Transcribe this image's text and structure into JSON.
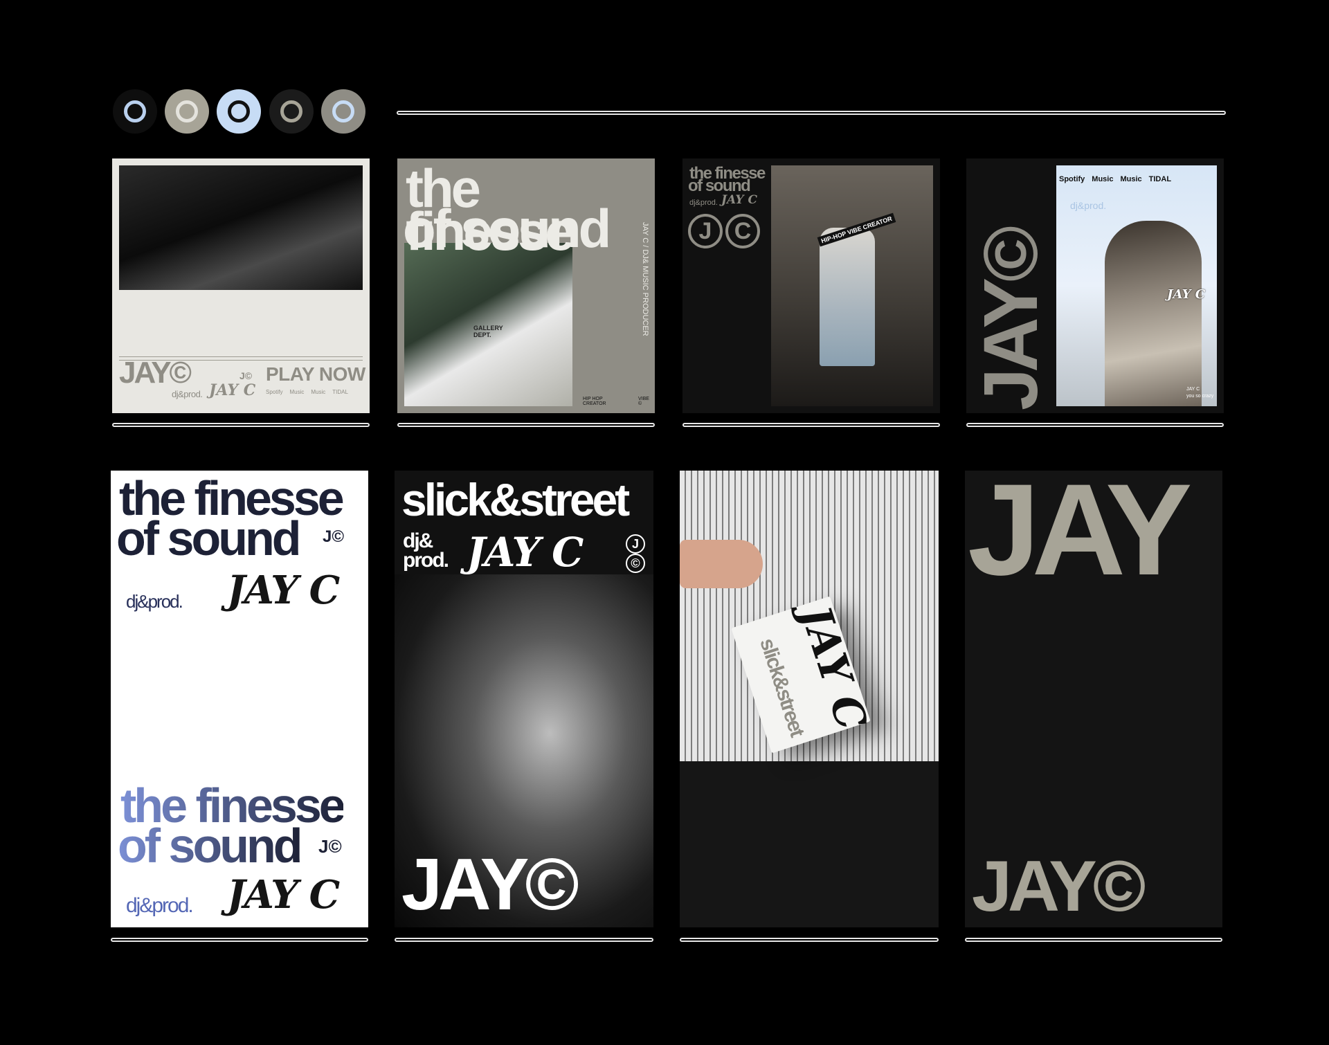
{
  "palette": {
    "swatches": [
      {
        "name": "swatch-black",
        "bg": "#0e0e0e",
        "ring": "#b9d0ee"
      },
      {
        "name": "swatch-taupe",
        "bg": "#a7a497",
        "ring": "#e4e3dd"
      },
      {
        "name": "swatch-blue",
        "bg": "#c7dcf5",
        "ring": "#111111"
      },
      {
        "name": "swatch-charcoal",
        "bg": "#1b1b1b",
        "ring": "#a7a497"
      },
      {
        "name": "swatch-grey",
        "bg": "#8f8d85",
        "ring": "#c7dcf5"
      }
    ]
  },
  "cards": {
    "c1": {
      "brand": "JAY©",
      "mark": "J©",
      "cta": "PLAY NOW",
      "sub": "dj&prod.",
      "sig": "JAY C",
      "platforms": [
        "Spotify",
        "Music",
        "Music",
        "TIDAL"
      ]
    },
    "c2": {
      "headline1": "the finesse",
      "headline2": "of sound",
      "vertical": "JAY C / DJ& MUSIC PRODUCER",
      "tag1": "HIP HOP CREATOR",
      "tag2": "VIBE ©",
      "shirt": "GALLERY DEPT."
    },
    "c3": {
      "headline1": "the finesse",
      "headline2": "of sound",
      "sub": "dj&prod.",
      "sig": "JAY C",
      "j": "J",
      "c": "C",
      "sticker": "HIP-HOP VIBE CREATOR"
    },
    "c4": {
      "vertical": "JAY©",
      "platforms": [
        "Spotify",
        "Music",
        "Music",
        "TIDAL"
      ],
      "sub": "dj&prod.",
      "sig": "JAY C",
      "foot1": "JAY C",
      "foot2": "you so crazy"
    },
    "c5": {
      "headline1": "the finesse",
      "headline2": "of sound",
      "mark": "J©",
      "sub": "dj&prod.",
      "sig": "JAY C",
      "headline3": "the finesse",
      "headline4": "of sound",
      "mark2": "J©",
      "sub2": "dj&prod.",
      "sig2": "JAY C"
    },
    "c6": {
      "headline": "slick&street",
      "sub1": "dj&",
      "sub2": "prod.",
      "sig": "JAY C",
      "j": "J",
      "c": "©",
      "brand": "JAY©"
    },
    "c7": {
      "card_text": "slick&street",
      "sig": "JAY C"
    },
    "c8": {
      "top": "JAY",
      "brand": "JAY©"
    }
  }
}
